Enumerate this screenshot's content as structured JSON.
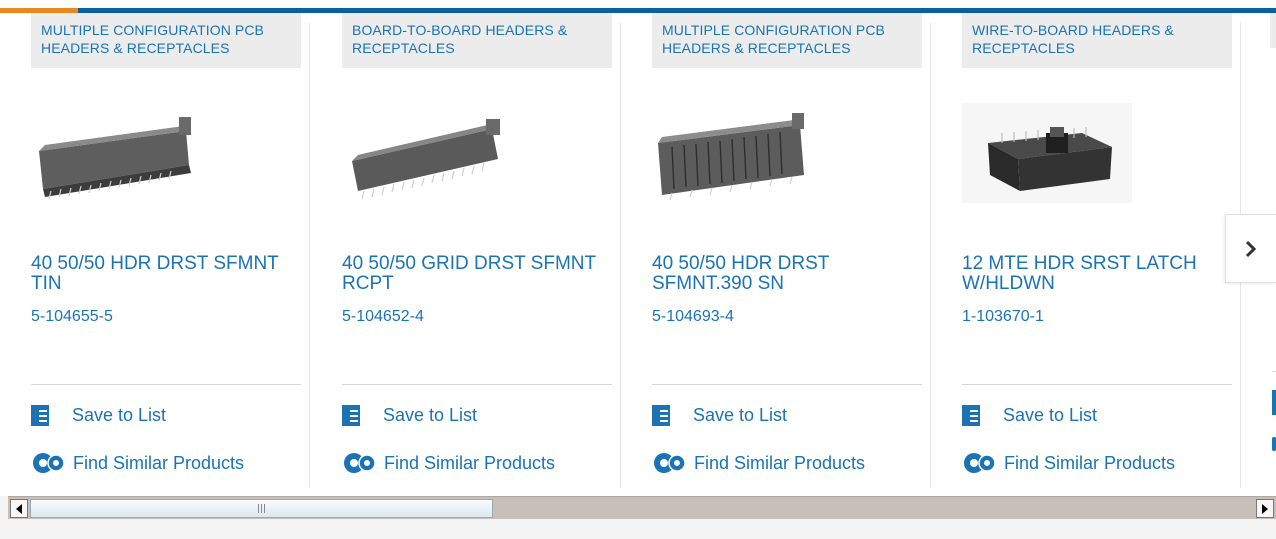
{
  "cards": [
    {
      "category": "MULTIPLE CONFIGURATION PCB HEADERS & RECEPTACLES",
      "title": "40 50/50 HDR DRST SFMNT TIN",
      "part_number": "5-104655-5",
      "save_label": "Save to List",
      "similar_label": "Find Similar Products"
    },
    {
      "category": "BOARD-TO-BOARD HEADERS & RECEPTACLES",
      "title": "40 50/50 GRID DRST SFMNT RCPT",
      "part_number": "5-104652-4",
      "save_label": "Save to List",
      "similar_label": "Find Similar Products"
    },
    {
      "category": "MULTIPLE CONFIGURATION PCB HEADERS & RECEPTACLES",
      "title": "40 50/50 HDR DRST SFMNT.390 SN",
      "part_number": "5-104693-4",
      "save_label": "Save to List",
      "similar_label": "Find Similar Products"
    },
    {
      "category": "WIRE-TO-BOARD HEADERS & RECEPTACLES",
      "title": "12 MTE HDR SRST LATCH W/HLDWN",
      "part_number": "1-103670-1",
      "save_label": "Save to List",
      "similar_label": "Find Similar Products"
    }
  ],
  "colors": {
    "brand_blue": "#1a73b5",
    "accent_orange": "#e8881e",
    "bar_blue": "#0a5fa1"
  },
  "icons": {
    "next": "chevron-right-icon",
    "save": "checklist-icon",
    "similar": "gears-icon"
  }
}
